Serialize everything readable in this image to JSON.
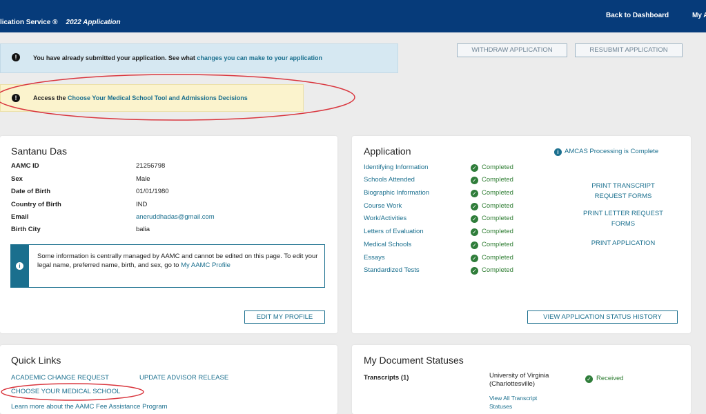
{
  "header": {
    "brand": "lication Service ®",
    "year_label": "2022 Application",
    "nav_dashboard": "Back to Dashboard",
    "nav_account": "My A"
  },
  "alerts": {
    "submitted_prefix": "You have already submitted your application. See what ",
    "submitted_link": "changes you can make to your application",
    "access_prefix": "Access the ",
    "access_link": "Choose Your Medical School Tool and Admissions Decisions"
  },
  "actions": {
    "withdraw": "WITHDRAW APPLICATION",
    "resubmit": "RESUBMIT APPLICATION"
  },
  "profile": {
    "name": "Santanu Das",
    "fields": [
      {
        "label": "AAMC ID",
        "value": "21256798"
      },
      {
        "label": "Sex",
        "value": "Male"
      },
      {
        "label": "Date of Birth",
        "value": "01/01/1980"
      },
      {
        "label": "Country of Birth",
        "value": "IND"
      },
      {
        "label": "Email",
        "value": "aneruddhadas@gmail.com"
      },
      {
        "label": "Birth City",
        "value": "balia"
      }
    ],
    "info_text": "Some information is centrally managed by AAMC and cannot be edited on this page. To edit your legal name, preferred name, birth, and sex, go to ",
    "info_link": "My AAMC Profile",
    "edit_button": "EDIT MY PROFILE"
  },
  "application": {
    "title": "Application",
    "processing": "AMCAS Processing is Complete",
    "sections": [
      {
        "label": "Identifying Information",
        "status": "Completed"
      },
      {
        "label": "Schools Attended",
        "status": "Completed"
      },
      {
        "label": "Biographic Information",
        "status": "Completed"
      },
      {
        "label": "Course Work",
        "status": "Completed"
      },
      {
        "label": "Work/Activities",
        "status": "Completed"
      },
      {
        "label": "Letters of Evaluation",
        "status": "Completed"
      },
      {
        "label": "Medical Schools",
        "status": "Completed"
      },
      {
        "label": "Essays",
        "status": "Completed"
      },
      {
        "label": "Standardized Tests",
        "status": "Completed"
      }
    ],
    "print_transcript_l1": "PRINT TRANSCRIPT",
    "print_transcript_l2": "REQUEST FORMS",
    "print_letter_l1": "PRINT LETTER REQUEST",
    "print_letter_l2": "FORMS",
    "print_application": "PRINT APPLICATION",
    "history_button": "VIEW APPLICATION STATUS HISTORY"
  },
  "quick_links": {
    "title": "Quick Links",
    "academic_change": "ACADEMIC CHANGE REQUEST",
    "advisor_release": "UPDATE ADVISOR RELEASE",
    "choose_school": "CHOOSE YOUR MEDICAL SCHOOL",
    "fee_assistance": "Learn more about the AAMC Fee Assistance Program"
  },
  "documents": {
    "title": "My Document Statuses",
    "transcripts_label": "Transcripts (1)",
    "school_l1": "University of Virginia",
    "school_l2": "(Charlottesville)",
    "status": "Received",
    "view_all_l1": "View All Transcript",
    "view_all_l2": "Statuses"
  },
  "colors": {
    "header": "#063b7a",
    "link": "#1a6f8e",
    "success": "#2f7d3a",
    "annotation": "#d9363e"
  }
}
